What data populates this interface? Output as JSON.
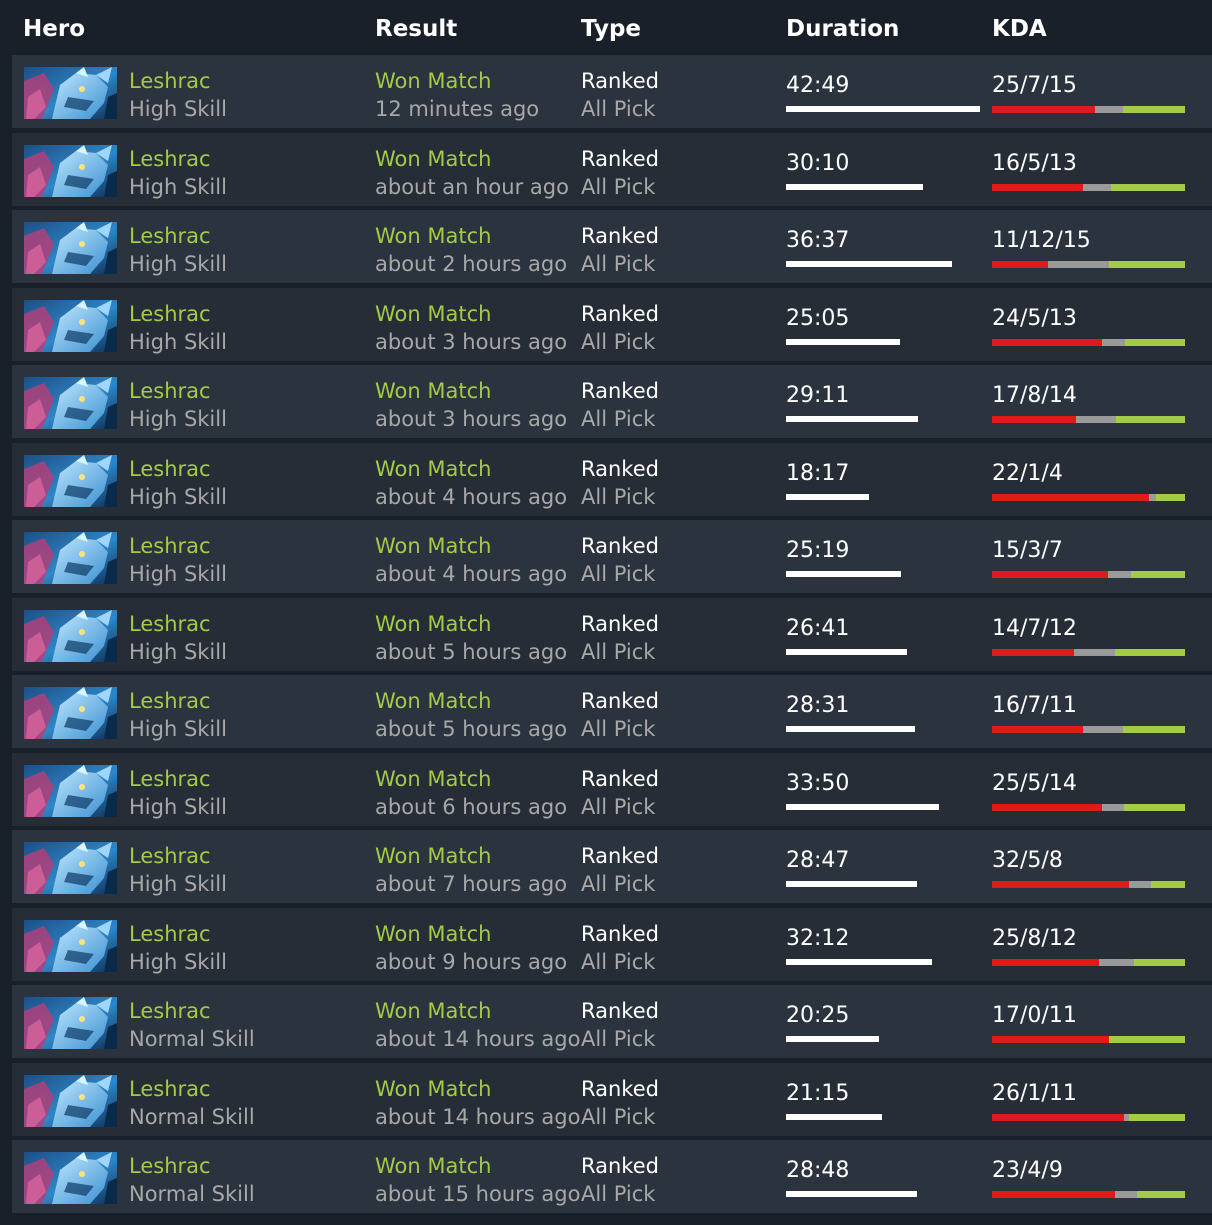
{
  "header": {
    "hero": "Hero",
    "result": "Result",
    "type": "Type",
    "duration": "Duration",
    "kda": "KDA"
  },
  "colors": {
    "won": "#a3cb45",
    "kills": "#de1b1b",
    "deaths": "#9a9a9a",
    "assists": "#a3cb45",
    "duration_bar": "#ffffff"
  },
  "matches": [
    {
      "hero_icon": "leshrac-portrait-icon",
      "hero": "Leshrac",
      "skill": "High Skill",
      "result": "Won Match",
      "time": "12 minutes ago",
      "lobby": "Ranked",
      "mode": "All Pick",
      "duration": "42:49",
      "kda": "25/7/15",
      "k": 25,
      "d": 7,
      "a": 15
    },
    {
      "hero_icon": "leshrac-portrait-icon",
      "hero": "Leshrac",
      "skill": "High Skill",
      "result": "Won Match",
      "time": "about an hour ago",
      "lobby": "Ranked",
      "mode": "All Pick",
      "duration": "30:10",
      "kda": "16/5/13",
      "k": 16,
      "d": 5,
      "a": 13
    },
    {
      "hero_icon": "leshrac-portrait-icon",
      "hero": "Leshrac",
      "skill": "High Skill",
      "result": "Won Match",
      "time": "about 2 hours ago",
      "lobby": "Ranked",
      "mode": "All Pick",
      "duration": "36:37",
      "kda": "11/12/15",
      "k": 11,
      "d": 12,
      "a": 15
    },
    {
      "hero_icon": "leshrac-portrait-icon",
      "hero": "Leshrac",
      "skill": "High Skill",
      "result": "Won Match",
      "time": "about 3 hours ago",
      "lobby": "Ranked",
      "mode": "All Pick",
      "duration": "25:05",
      "kda": "24/5/13",
      "k": 24,
      "d": 5,
      "a": 13
    },
    {
      "hero_icon": "leshrac-portrait-icon",
      "hero": "Leshrac",
      "skill": "High Skill",
      "result": "Won Match",
      "time": "about 3 hours ago",
      "lobby": "Ranked",
      "mode": "All Pick",
      "duration": "29:11",
      "kda": "17/8/14",
      "k": 17,
      "d": 8,
      "a": 14
    },
    {
      "hero_icon": "leshrac-portrait-icon",
      "hero": "Leshrac",
      "skill": "High Skill",
      "result": "Won Match",
      "time": "about 4 hours ago",
      "lobby": "Ranked",
      "mode": "All Pick",
      "duration": "18:17",
      "kda": "22/1/4",
      "k": 22,
      "d": 1,
      "a": 4
    },
    {
      "hero_icon": "leshrac-portrait-icon",
      "hero": "Leshrac",
      "skill": "High Skill",
      "result": "Won Match",
      "time": "about 4 hours ago",
      "lobby": "Ranked",
      "mode": "All Pick",
      "duration": "25:19",
      "kda": "15/3/7",
      "k": 15,
      "d": 3,
      "a": 7
    },
    {
      "hero_icon": "leshrac-portrait-icon",
      "hero": "Leshrac",
      "skill": "High Skill",
      "result": "Won Match",
      "time": "about 5 hours ago",
      "lobby": "Ranked",
      "mode": "All Pick",
      "duration": "26:41",
      "kda": "14/7/12",
      "k": 14,
      "d": 7,
      "a": 12
    },
    {
      "hero_icon": "leshrac-portrait-icon",
      "hero": "Leshrac",
      "skill": "High Skill",
      "result": "Won Match",
      "time": "about 5 hours ago",
      "lobby": "Ranked",
      "mode": "All Pick",
      "duration": "28:31",
      "kda": "16/7/11",
      "k": 16,
      "d": 7,
      "a": 11
    },
    {
      "hero_icon": "leshrac-portrait-icon",
      "hero": "Leshrac",
      "skill": "High Skill",
      "result": "Won Match",
      "time": "about 6 hours ago",
      "lobby": "Ranked",
      "mode": "All Pick",
      "duration": "33:50",
      "kda": "25/5/14",
      "k": 25,
      "d": 5,
      "a": 14
    },
    {
      "hero_icon": "leshrac-portrait-icon",
      "hero": "Leshrac",
      "skill": "High Skill",
      "result": "Won Match",
      "time": "about 7 hours ago",
      "lobby": "Ranked",
      "mode": "All Pick",
      "duration": "28:47",
      "kda": "32/5/8",
      "k": 32,
      "d": 5,
      "a": 8
    },
    {
      "hero_icon": "leshrac-portrait-icon",
      "hero": "Leshrac",
      "skill": "High Skill",
      "result": "Won Match",
      "time": "about 9 hours ago",
      "lobby": "Ranked",
      "mode": "All Pick",
      "duration": "32:12",
      "kda": "25/8/12",
      "k": 25,
      "d": 8,
      "a": 12
    },
    {
      "hero_icon": "leshrac-portrait-icon",
      "hero": "Leshrac",
      "skill": "Normal Skill",
      "result": "Won Match",
      "time": "about 14 hours ago",
      "lobby": "Ranked",
      "mode": "All Pick",
      "duration": "20:25",
      "kda": "17/0/11",
      "k": 17,
      "d": 0,
      "a": 11
    },
    {
      "hero_icon": "leshrac-portrait-icon",
      "hero": "Leshrac",
      "skill": "Normal Skill",
      "result": "Won Match",
      "time": "about 14 hours ago",
      "lobby": "Ranked",
      "mode": "All Pick",
      "duration": "21:15",
      "kda": "26/1/11",
      "k": 26,
      "d": 1,
      "a": 11
    },
    {
      "hero_icon": "leshrac-portrait-icon",
      "hero": "Leshrac",
      "skill": "Normal Skill",
      "result": "Won Match",
      "time": "about 15 hours ago",
      "lobby": "Ranked",
      "mode": "All Pick",
      "duration": "28:48",
      "kda": "23/4/9",
      "k": 23,
      "d": 4,
      "a": 9
    }
  ]
}
